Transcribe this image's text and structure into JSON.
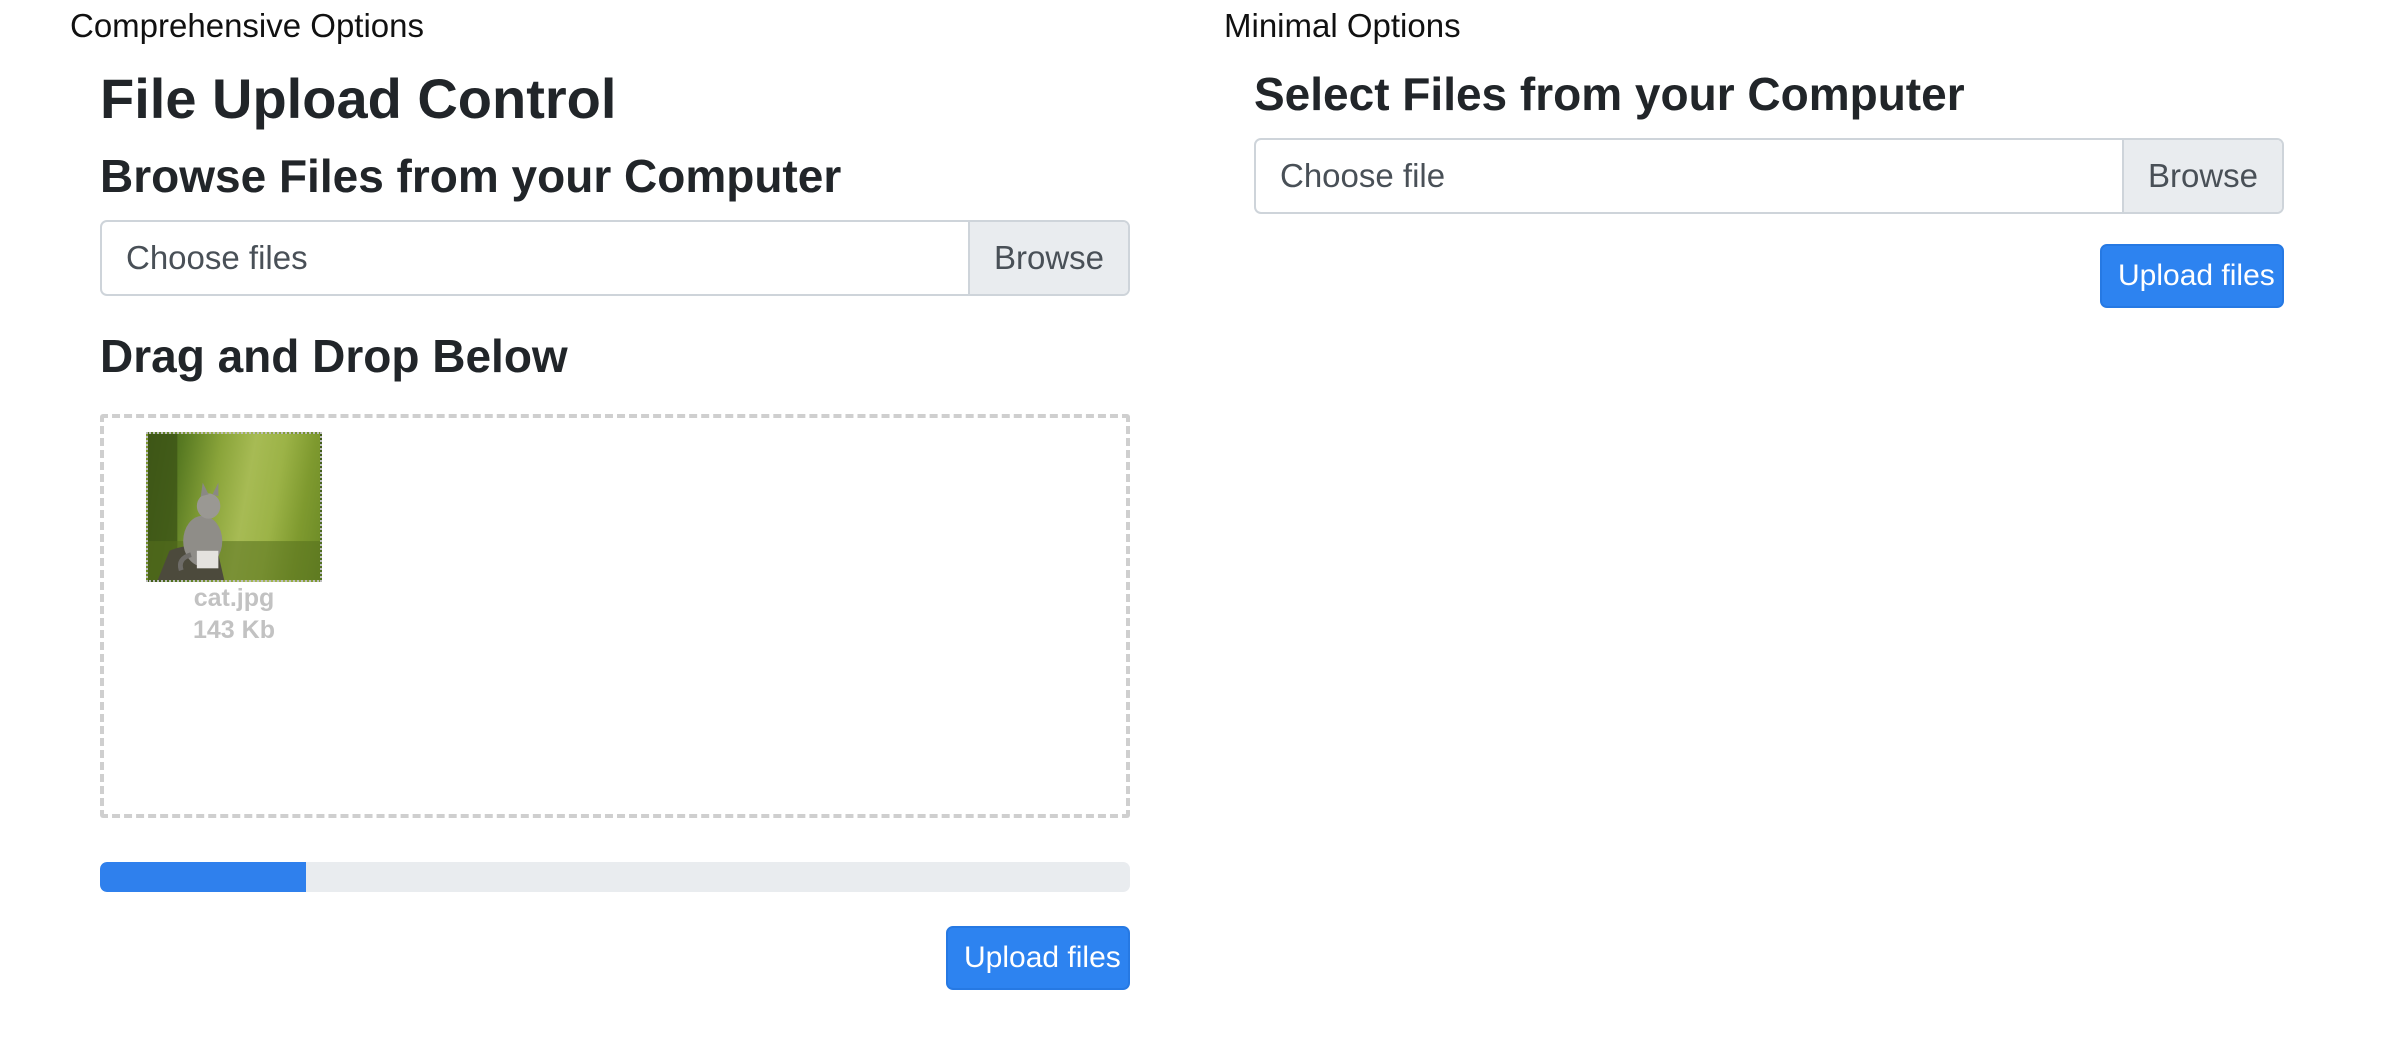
{
  "comprehensive": {
    "section_label": "Comprehensive Options",
    "title": "File Upload Control",
    "browse_heading": "Browse Files from your Computer",
    "file_input": {
      "placeholder": "Choose files",
      "browse_label": "Browse"
    },
    "drag_heading": "Drag and Drop Below",
    "files": [
      {
        "name": "cat.jpg",
        "size": "143 Kb",
        "thumbnail": "cat-photo"
      }
    ],
    "progress_fraction": 0.2,
    "upload_label": "Upload files"
  },
  "minimal": {
    "section_label": "Minimal Options",
    "heading": "Select Files from your Computer",
    "file_input": {
      "placeholder": "Choose file",
      "browse_label": "Browse"
    },
    "upload_label": "Upload files"
  },
  "colors": {
    "primary": "#2d83f0",
    "progress_track": "#e9ecef",
    "dropzone_border": "#cfcfcf"
  }
}
